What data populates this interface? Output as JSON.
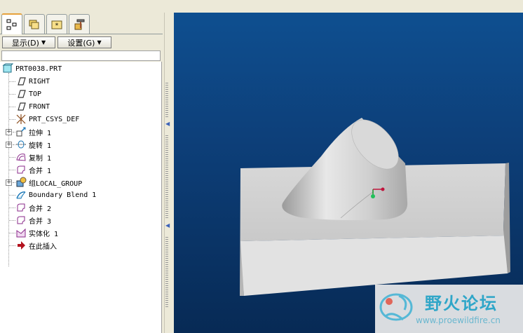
{
  "tabs": [
    {
      "name": "model-tree-tab",
      "icon": "model-tree-icon",
      "active": true
    },
    {
      "name": "folder-browser-tab",
      "icon": "folders-icon",
      "active": false
    },
    {
      "name": "favorites-tab",
      "icon": "favorites-icon",
      "active": false
    },
    {
      "name": "connections-tab",
      "icon": "hammer-icon",
      "active": false
    }
  ],
  "toolbar": {
    "show_label": "显示(D)",
    "settings_label": "设置(G)"
  },
  "tree": {
    "root": "PRT0038.PRT",
    "items": [
      {
        "label": "RIGHT",
        "icon": "datum-plane-icon",
        "expandable": false
      },
      {
        "label": "TOP",
        "icon": "datum-plane-icon",
        "expandable": false
      },
      {
        "label": "FRONT",
        "icon": "datum-plane-icon",
        "expandable": false
      },
      {
        "label": "PRT_CSYS_DEF",
        "icon": "csys-icon",
        "expandable": false
      },
      {
        "label": "拉伸 1",
        "icon": "extrude-icon",
        "expandable": true
      },
      {
        "label": "旋转 1",
        "icon": "revolve-icon",
        "expandable": true
      },
      {
        "label": "复制 1",
        "icon": "copy-surface-icon",
        "expandable": false
      },
      {
        "label": "合并 1",
        "icon": "merge-icon",
        "expandable": false
      },
      {
        "label": "组LOCAL_GROUP",
        "icon": "group-icon",
        "expandable": true
      },
      {
        "label": "Boundary Blend 1",
        "icon": "boundary-blend-icon",
        "expandable": false
      },
      {
        "label": "合并 2",
        "icon": "merge-icon",
        "expandable": false
      },
      {
        "label": "合并 3",
        "icon": "merge-icon",
        "expandable": false
      },
      {
        "label": "实体化 1",
        "icon": "solidify-icon",
        "expandable": false
      },
      {
        "label": "在此插入",
        "icon": "insert-here-arrow-icon",
        "expandable": false
      }
    ]
  },
  "viewport": {
    "background_top": "#0e4f90",
    "background_bottom": "#072a55",
    "model_color": "#d6d6d6"
  },
  "watermark": {
    "title": "野火论坛",
    "url": "www.proewildfire.cn"
  }
}
